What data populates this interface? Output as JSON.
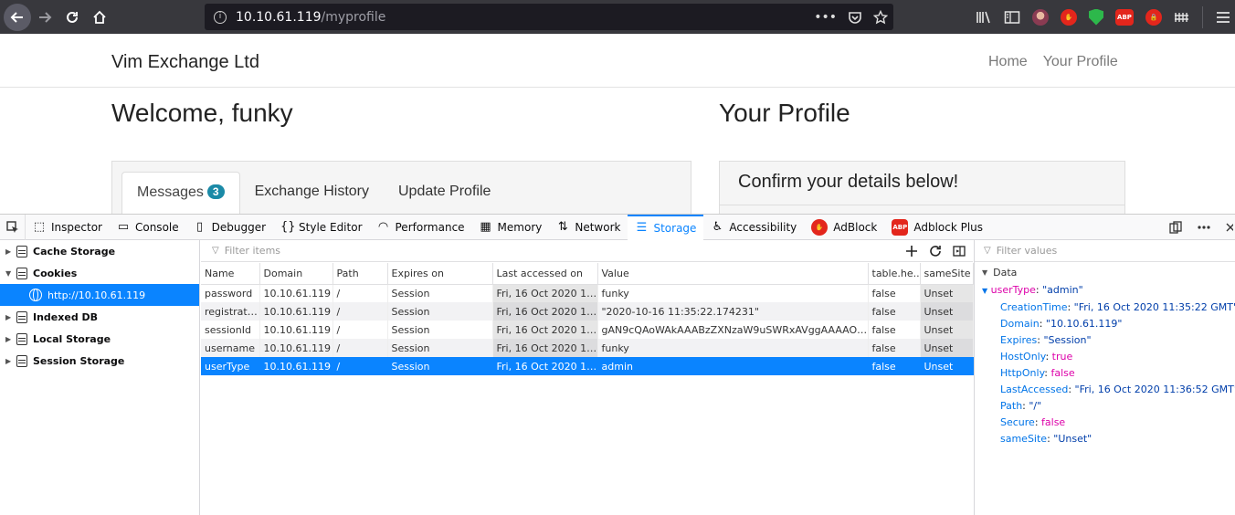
{
  "browser": {
    "url_host": "10.10.61.119",
    "url_path": "/myprofile",
    "url_more": "•••",
    "extensions": [
      "library-icon",
      "sidebar-icon",
      "avatar",
      "stop-icon",
      "shield-icon",
      "abp-icon",
      "lock-icon",
      "extension-icon",
      "menu-icon"
    ],
    "abp_text": "ABP"
  },
  "site": {
    "brand": "Vim Exchange Ltd",
    "nav": [
      "Home",
      "Your Profile"
    ],
    "welcome": "Welcome, funky",
    "profile_heading": "Your Profile",
    "tabs": [
      "Messages",
      "Exchange History",
      "Update Profile"
    ],
    "messages_count": "3",
    "confirm_text": "Confirm your details below!"
  },
  "devtools": {
    "tabs": [
      "Inspector",
      "Console",
      "Debugger",
      "Style Editor",
      "Performance",
      "Memory",
      "Network",
      "Storage",
      "Accessibility",
      "AdBlock",
      "Adblock Plus"
    ],
    "active_tab": "Storage",
    "abp_text": "ABP",
    "sidebar": {
      "items": [
        "Cache Storage",
        "Cookies",
        "http://10.10.61.119",
        "Indexed DB",
        "Local Storage",
        "Session Storage"
      ]
    },
    "filter_items_placeholder": "Filter items",
    "filter_values_placeholder": "Filter values",
    "columns": [
      "Name",
      "Domain",
      "Path",
      "Expires on",
      "Last accessed on",
      "Value",
      "table.he...",
      "sameSite"
    ],
    "rows": [
      [
        "password",
        "10.10.61.119",
        "/",
        "Session",
        "Fri, 16 Oct 2020 11:3...",
        "funky",
        "false",
        "Unset"
      ],
      [
        "registrati...",
        "10.10.61.119",
        "/",
        "Session",
        "Fri, 16 Oct 2020 11:3...",
        "\"2020-10-16 11:35:22.174231\"",
        "false",
        "Unset"
      ],
      [
        "sessionId",
        "10.10.61.119",
        "/",
        "Session",
        "Fri, 16 Oct 2020 11:3...",
        "gAN9cQAoWAkAAABzZXNzaW9uSWRxAVggAAAAODA...",
        "false",
        "Unset"
      ],
      [
        "username",
        "10.10.61.119",
        "/",
        "Session",
        "Fri, 16 Oct 2020 11:3...",
        "funky",
        "false",
        "Unset"
      ],
      [
        "userType",
        "10.10.61.119",
        "/",
        "Session",
        "Fri, 16 Oct 2020 11:3...",
        "admin",
        "false",
        "Unset"
      ]
    ],
    "selected_row": 4,
    "details": {
      "header": "Data",
      "root_key": "userType",
      "root_value": "\"admin\"",
      "props": [
        {
          "key": "CreationTime",
          "value": "\"Fri, 16 Oct 2020 11:35:22 GMT\"",
          "kind": "s"
        },
        {
          "key": "Domain",
          "value": "\"10.10.61.119\"",
          "kind": "s"
        },
        {
          "key": "Expires",
          "value": "\"Session\"",
          "kind": "s"
        },
        {
          "key": "HostOnly",
          "value": "true",
          "kind": "b"
        },
        {
          "key": "HttpOnly",
          "value": "false",
          "kind": "b"
        },
        {
          "key": "LastAccessed",
          "value": "\"Fri, 16 Oct 2020 11:36:52 GMT\"",
          "kind": "s"
        },
        {
          "key": "Path",
          "value": "\"/\"",
          "kind": "s"
        },
        {
          "key": "Secure",
          "value": "false",
          "kind": "b"
        },
        {
          "key": "sameSite",
          "value": "\"Unset\"",
          "kind": "s"
        }
      ]
    }
  }
}
